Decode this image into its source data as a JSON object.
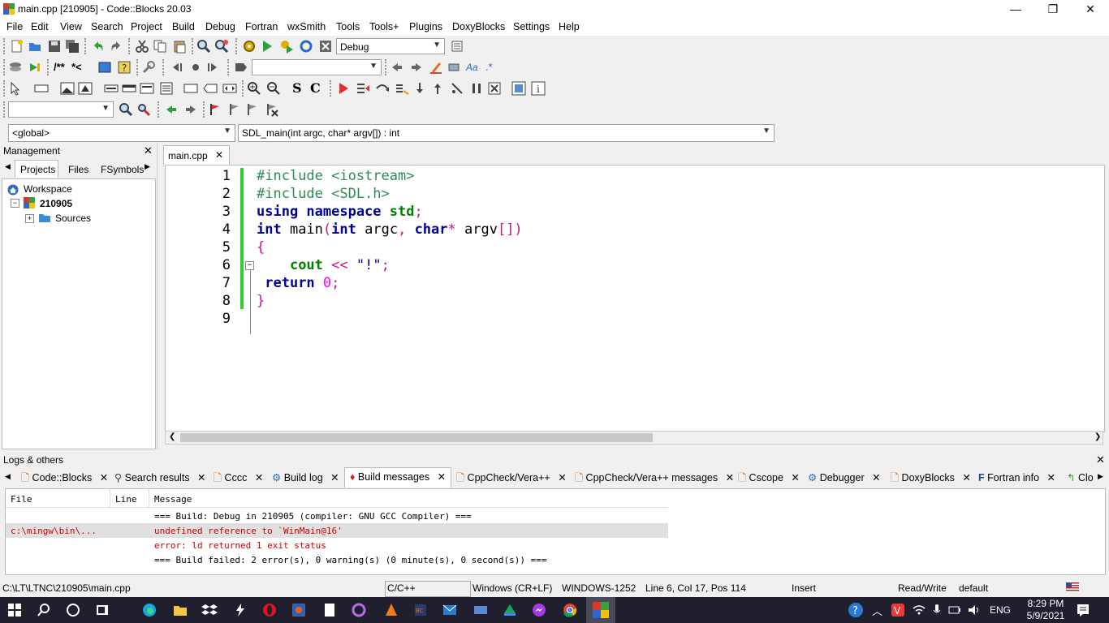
{
  "window": {
    "title": "main.cpp [210905] - Code::Blocks 20.03",
    "minimize": "—",
    "maximize": "❐",
    "close": "✕"
  },
  "menu": [
    "File",
    "Edit",
    "View",
    "Search",
    "Project",
    "Build",
    "Debug",
    "Fortran",
    "wxSmith",
    "Tools",
    "Tools+",
    "Plugins",
    "DoxyBlocks",
    "Settings",
    "Help"
  ],
  "toolbar": {
    "build_target": "Debug",
    "scope": "<global>",
    "function": "SDL_main(int argc, char* argv[]) : int",
    "s_label": "S",
    "c_label": "C"
  },
  "management": {
    "title": "Management",
    "close": "✕",
    "tabs": [
      "Projects",
      "Files",
      "FSymbols"
    ],
    "tree": {
      "workspace": "Workspace",
      "project": "210905",
      "folder": "Sources"
    }
  },
  "editor": {
    "tab": "main.cpp",
    "tab_close": "✕",
    "lines": [
      "1",
      "2",
      "3",
      "4",
      "5",
      "6",
      "7",
      "8",
      "9"
    ]
  },
  "logs": {
    "title": "Logs & others",
    "close": "✕",
    "tabs": [
      "Code::Blocks",
      "Search results",
      "Cccc",
      "Build log",
      "Build messages",
      "CppCheck/Vera++",
      "CppCheck/Vera++ messages",
      "Cscope",
      "Debugger",
      "DoxyBlocks",
      "Fortran info",
      "Clo"
    ],
    "columns": [
      "File",
      "Line",
      "Message"
    ],
    "rows": [
      {
        "file": "",
        "line": "",
        "message": "=== Build: Debug in 210905 (compiler: GNU GCC Compiler) ==="
      },
      {
        "file": "c:\\mingw\\bin\\...",
        "line": "",
        "message": "undefined reference to `WinMain@16'"
      },
      {
        "file": "",
        "line": "",
        "message": "error: ld returned 1 exit status"
      },
      {
        "file": "",
        "line": "",
        "message": "=== Build failed: 2 error(s), 0 warning(s) (0 minute(s), 0 second(s)) ==="
      }
    ]
  },
  "status": {
    "path": "C:\\LT\\LTNC\\210905\\main.cpp",
    "language": "C/C++",
    "eol": "Windows (CR+LF)",
    "encoding": "WINDOWS-1252",
    "position": "Line 6, Col 17, Pos 114",
    "mode": "Insert",
    "access": "Read/Write",
    "profile": "default"
  },
  "taskbar": {
    "lang": "ENG",
    "time": "8:29 PM",
    "date": "5/9/2021"
  },
  "colors": {
    "error_text": "#cc0000",
    "change_bar": "#33cc33",
    "taskbar": "#1f1f2e"
  }
}
